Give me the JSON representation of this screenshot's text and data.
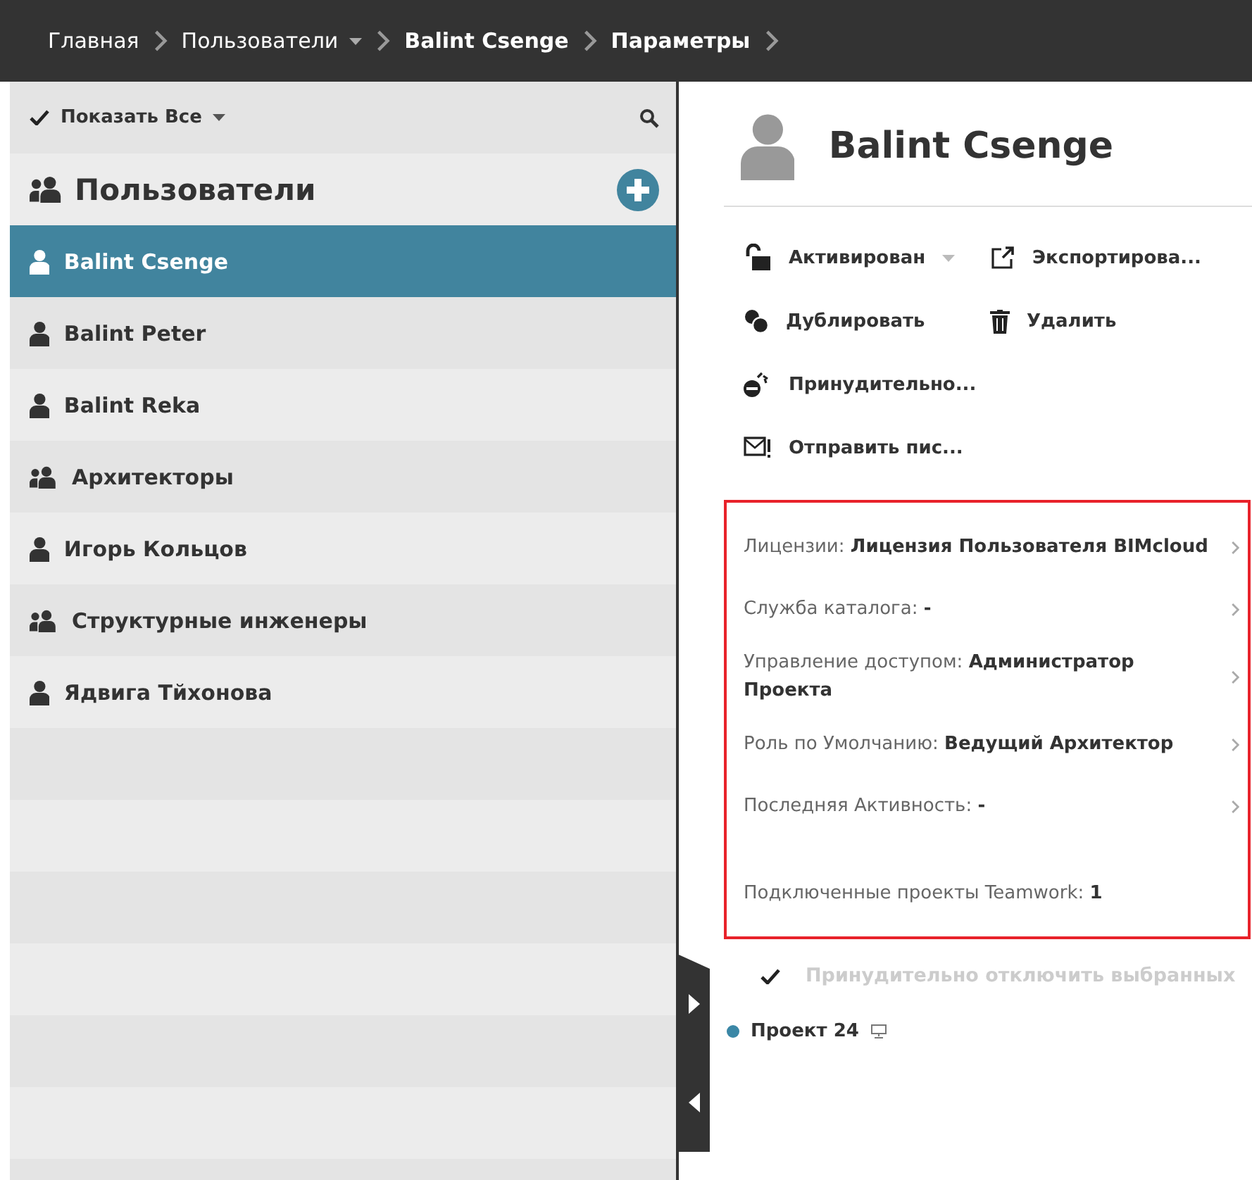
{
  "breadcrumb": [
    {
      "label": "Главная",
      "bold": false,
      "dropdown": false
    },
    {
      "label": "Пользователи",
      "bold": false,
      "dropdown": true
    },
    {
      "label": "Balint Csenge",
      "bold": true,
      "dropdown": false
    },
    {
      "label": "Параметры",
      "bold": true,
      "dropdown": false
    }
  ],
  "sidebar": {
    "filter": {
      "label": "Показать Все",
      "checked": true
    },
    "title": "Пользователи",
    "items": [
      {
        "kind": "user",
        "label": "Balint Csenge",
        "selected": true
      },
      {
        "kind": "user",
        "label": "Balint Peter",
        "selected": false
      },
      {
        "kind": "user",
        "label": "Balint Reka",
        "selected": false
      },
      {
        "kind": "group",
        "label": "Архитекторы",
        "selected": false
      },
      {
        "kind": "user",
        "label": "Игорь Кольцов",
        "selected": false
      },
      {
        "kind": "group",
        "label": "Структурные инженеры",
        "selected": false
      },
      {
        "kind": "user",
        "label": "Ядвига Тйхонова",
        "selected": false
      }
    ]
  },
  "detail": {
    "name": "Balint Csenge",
    "action_rows": [
      [
        {
          "kind": "unlock",
          "label": "Активирован",
          "dropdown": true
        },
        {
          "kind": "export",
          "label": "Экспортирова...",
          "dropdown": false
        }
      ],
      [
        {
          "kind": "duplicate",
          "label": "Дублировать",
          "dropdown": false
        },
        {
          "kind": "delete",
          "label": "Удалить",
          "dropdown": false
        }
      ],
      [
        {
          "kind": "force",
          "label": "Принудительно...",
          "dropdown": false
        }
      ],
      [
        {
          "kind": "mail",
          "label": "Отправить пис...",
          "dropdown": false
        }
      ]
    ],
    "properties": [
      {
        "kind": "link",
        "label": "Лицензии:",
        "value": "Лицензия Пользователя BIMcloud"
      },
      {
        "kind": "link",
        "label": "Служба каталога:",
        "value": "-"
      },
      {
        "kind": "link",
        "label": "Управление доступом:",
        "value": "Администратор Проекта"
      },
      {
        "kind": "link",
        "label": "Роль по Умолчанию:",
        "value": "Ведущий Архитектор"
      },
      {
        "kind": "link",
        "label": "Последняя Активность:",
        "value": "-"
      },
      {
        "kind": "info",
        "label": "Подключенные проекты Teamwork:",
        "value": "1"
      }
    ],
    "disconnect": {
      "label": "Принудительно отключить выбранных",
      "checked": true,
      "disabled": true
    },
    "projects": [
      {
        "label": "Проект 24",
        "color": "#3b87a6"
      }
    ]
  }
}
